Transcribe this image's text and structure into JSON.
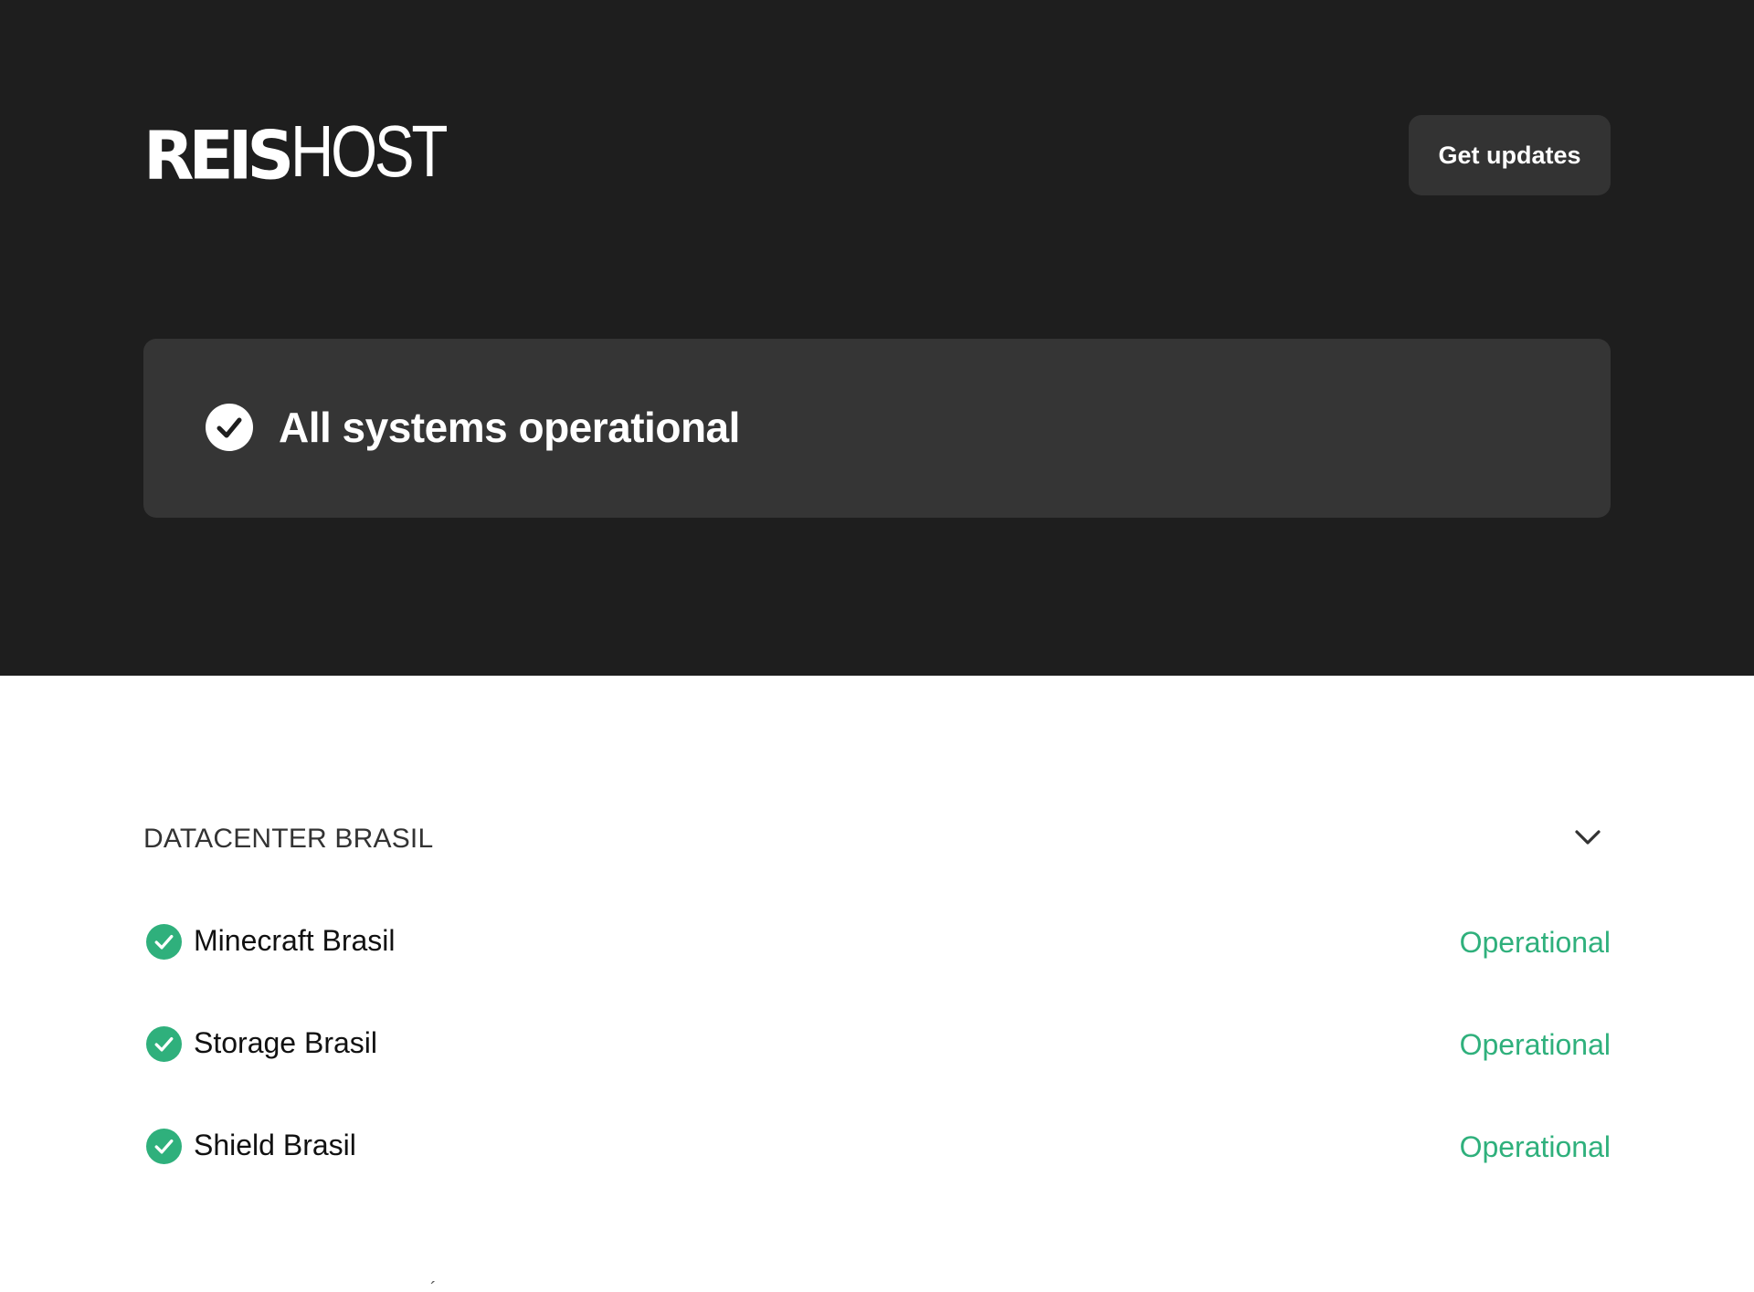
{
  "header": {
    "logo_bold": "REIS",
    "logo_thin": "HOST",
    "get_updates_label": "Get updates"
  },
  "banner": {
    "icon": "check-circle-icon",
    "text": "All systems operational"
  },
  "group": {
    "title": "DATACENTER BRASIL",
    "toggle_icon": "chevron-down-icon",
    "components": [
      {
        "name": "Minecraft Brasil",
        "status": "Operational",
        "icon": "check-circle-icon"
      },
      {
        "name": "Storage Brasil",
        "status": "Operational",
        "icon": "check-circle-icon"
      },
      {
        "name": "Shield Brasil",
        "status": "Operational",
        "icon": "check-circle-icon"
      }
    ]
  },
  "colors": {
    "hero_bg": "#1e1e1e",
    "banner_bg": "#353535",
    "button_bg": "#333333",
    "operational": "#2fb07c"
  }
}
